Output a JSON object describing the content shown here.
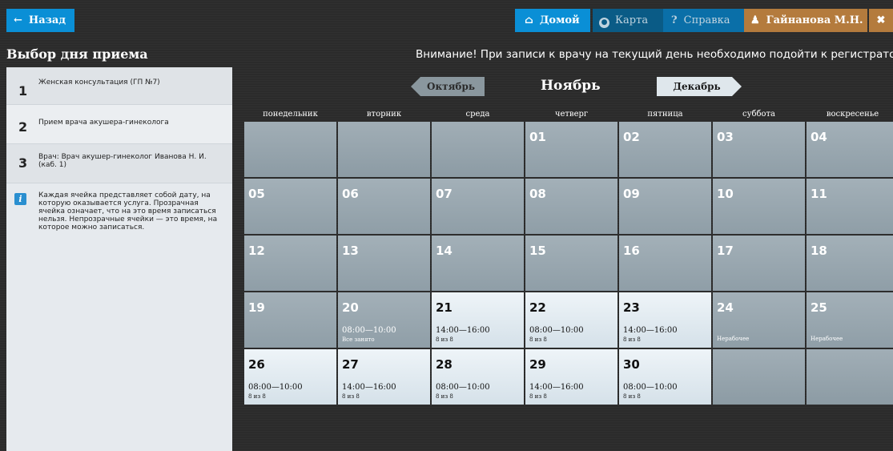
{
  "topbar": {
    "back": {
      "icon": "arrow-left-icon",
      "label": "Назад"
    },
    "home": {
      "icon": "home-icon",
      "label": "Домой"
    },
    "map": {
      "icon": "map-marker-icon",
      "label": "Карта"
    },
    "help": {
      "icon": "question-icon",
      "label": "Справка"
    },
    "user": {
      "icon": "user-icon",
      "label": "Гайнанова М.Н."
    },
    "close": {
      "icon": "close-icon",
      "glyph": "✖"
    }
  },
  "page_title": "Выбор дня приема",
  "notice": "Внимание! При записи к врачу на текущий день необходимо подойти к регистратор",
  "steps": [
    {
      "num": "1",
      "text": "Женская консультация (ГП №7)"
    },
    {
      "num": "2",
      "text": "Прием врача акушера-гинеколога"
    },
    {
      "num": "3",
      "text": "Врач: Врач акушер-гинеколог Иванова Н. И. (каб. 1)"
    }
  ],
  "info": {
    "icon": "info-icon",
    "text": "Каждая ячейка представляет собой дату, на которую оказывается услуга. Прозрачная ячейка означает, что на это время записаться нельзя. Непрозрачные ячейки — это время, на которое можно записаться."
  },
  "months": {
    "prev": "Октябрь",
    "current": "Ноябрь",
    "next": "Декабрь"
  },
  "weekdays": [
    "понедельник",
    "вторник",
    "среда",
    "четверг",
    "пятница",
    "суббота",
    "воскресенье"
  ],
  "weeks": [
    [
      {
        "day": "",
        "state": "empty"
      },
      {
        "day": "",
        "state": "empty"
      },
      {
        "day": "",
        "state": "empty"
      },
      {
        "day": "01",
        "state": "past"
      },
      {
        "day": "02",
        "state": "past"
      },
      {
        "day": "03",
        "state": "past"
      },
      {
        "day": "04",
        "state": "past"
      }
    ],
    [
      {
        "day": "05",
        "state": "past"
      },
      {
        "day": "06",
        "state": "past"
      },
      {
        "day": "07",
        "state": "past"
      },
      {
        "day": "08",
        "state": "past"
      },
      {
        "day": "09",
        "state": "past"
      },
      {
        "day": "10",
        "state": "past"
      },
      {
        "day": "11",
        "state": "past"
      }
    ],
    [
      {
        "day": "12",
        "state": "past"
      },
      {
        "day": "13",
        "state": "past"
      },
      {
        "day": "14",
        "state": "past"
      },
      {
        "day": "15",
        "state": "past"
      },
      {
        "day": "16",
        "state": "past"
      },
      {
        "day": "17",
        "state": "past"
      },
      {
        "day": "18",
        "state": "past"
      }
    ],
    [
      {
        "day": "19",
        "state": "past"
      },
      {
        "day": "20",
        "state": "full",
        "time": "08:00—10:00",
        "sub": "Все занято"
      },
      {
        "day": "21",
        "state": "avail",
        "time": "14:00—16:00",
        "sub": "8 из 8"
      },
      {
        "day": "22",
        "state": "avail",
        "time": "08:00—10:00",
        "sub": "8 из 8"
      },
      {
        "day": "23",
        "state": "avail",
        "time": "14:00—16:00",
        "sub": "8 из 8"
      },
      {
        "day": "24",
        "state": "off",
        "sub": "Нерабочее"
      },
      {
        "day": "25",
        "state": "off",
        "sub": "Нерабочее"
      }
    ],
    [
      {
        "day": "26",
        "state": "avail",
        "time": "08:00—10:00",
        "sub": "8 из 8"
      },
      {
        "day": "27",
        "state": "avail",
        "time": "14:00—16:00",
        "sub": "8 из 8"
      },
      {
        "day": "28",
        "state": "avail",
        "time": "08:00—10:00",
        "sub": "8 из 8"
      },
      {
        "day": "29",
        "state": "avail",
        "time": "14:00—16:00",
        "sub": "8 из 8"
      },
      {
        "day": "30",
        "state": "avail",
        "time": "08:00—10:00",
        "sub": "8 из 8"
      },
      {
        "day": "",
        "state": "empty"
      },
      {
        "day": "",
        "state": "empty"
      }
    ]
  ]
}
